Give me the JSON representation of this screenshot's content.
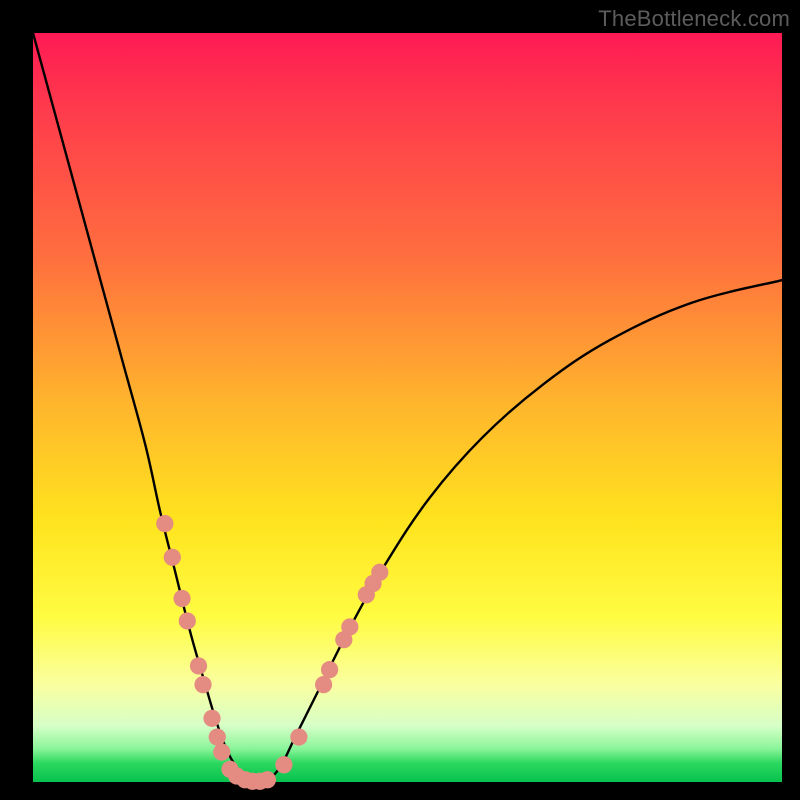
{
  "watermark": "TheBottleneck.com",
  "colors": {
    "curve": "#000000",
    "dots": "#e48b82",
    "gradient_stops": [
      "#ff1a54",
      "#ff3a4c",
      "#ff6f3e",
      "#ffb72c",
      "#ffe31e",
      "#fffc42",
      "#faffa0",
      "#d6ffc7",
      "#8cf59b",
      "#2bd85f",
      "#07c24e"
    ]
  },
  "chart_data": {
    "type": "line",
    "title": "",
    "xlabel": "",
    "ylabel": "",
    "ylim": [
      0,
      100
    ],
    "xlim": [
      0,
      100
    ],
    "series": [
      {
        "name": "bottleneck-curve",
        "x": [
          0,
          3,
          6,
          9,
          12,
          15,
          17,
          19,
          21,
          23,
          24.5,
          26,
          27.5,
          29,
          31,
          33,
          35,
          38,
          42,
          47,
          53,
          60,
          68,
          77,
          88,
          100
        ],
        "values": [
          100,
          89,
          78,
          67,
          56,
          45,
          36,
          28,
          20,
          13,
          8,
          4,
          1.5,
          0,
          0,
          2,
          6,
          12,
          20,
          29,
          38,
          46,
          53,
          59,
          64,
          67
        ]
      }
    ],
    "markers": {
      "name": "highlight-dots",
      "color": "#e48b82",
      "radius_pct": 1.15,
      "points": [
        {
          "x": 17.6,
          "y": 34.5
        },
        {
          "x": 18.6,
          "y": 30.0
        },
        {
          "x": 19.9,
          "y": 24.5
        },
        {
          "x": 20.6,
          "y": 21.5
        },
        {
          "x": 22.1,
          "y": 15.5
        },
        {
          "x": 22.7,
          "y": 13.0
        },
        {
          "x": 23.9,
          "y": 8.5
        },
        {
          "x": 24.6,
          "y": 6.0
        },
        {
          "x": 25.2,
          "y": 4.0
        },
        {
          "x": 26.3,
          "y": 1.7
        },
        {
          "x": 27.2,
          "y": 0.8
        },
        {
          "x": 28.3,
          "y": 0.3
        },
        {
          "x": 29.3,
          "y": 0.1
        },
        {
          "x": 30.3,
          "y": 0.1
        },
        {
          "x": 31.3,
          "y": 0.3
        },
        {
          "x": 33.5,
          "y": 2.3
        },
        {
          "x": 35.5,
          "y": 6.0
        },
        {
          "x": 38.8,
          "y": 13.0
        },
        {
          "x": 39.6,
          "y": 15.0
        },
        {
          "x": 41.5,
          "y": 19.0
        },
        {
          "x": 42.3,
          "y": 20.7
        },
        {
          "x": 44.5,
          "y": 25.0
        },
        {
          "x": 45.4,
          "y": 26.5
        },
        {
          "x": 46.3,
          "y": 28.0
        }
      ]
    }
  }
}
